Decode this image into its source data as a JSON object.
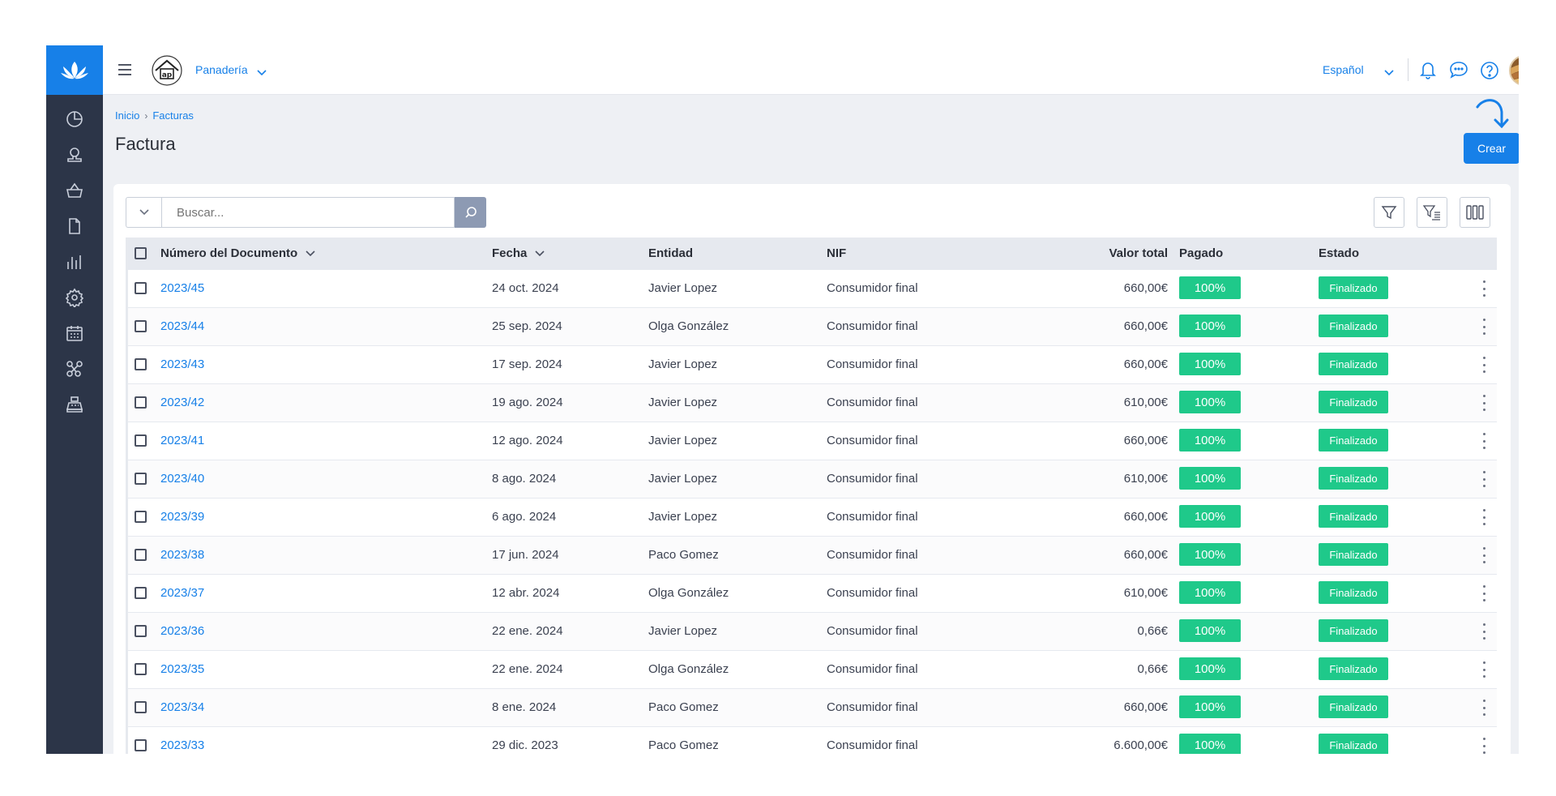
{
  "topbar": {
    "company": "Panadería",
    "language": "Español"
  },
  "breadcrumb": [
    "Inicio",
    "Facturas"
  ],
  "page": {
    "title": "Factura",
    "create_label": "Crear"
  },
  "search": {
    "placeholder": "Buscar..."
  },
  "table": {
    "headers": {
      "number": "Número del Documento",
      "date": "Fecha",
      "entity": "Entidad",
      "nif": "NIF",
      "total": "Valor total",
      "paid": "Pagado",
      "status": "Estado"
    },
    "rows": [
      {
        "number": "2023/45",
        "date": "24 oct. 2024",
        "entity": "Javier Lopez",
        "nif": "Consumidor final",
        "total": "660,00€",
        "paid": "100%",
        "status": "Finalizado"
      },
      {
        "number": "2023/44",
        "date": "25 sep. 2024",
        "entity": "Olga González",
        "nif": "Consumidor final",
        "total": "660,00€",
        "paid": "100%",
        "status": "Finalizado"
      },
      {
        "number": "2023/43",
        "date": "17 sep. 2024",
        "entity": "Javier Lopez",
        "nif": "Consumidor final",
        "total": "660,00€",
        "paid": "100%",
        "status": "Finalizado"
      },
      {
        "number": "2023/42",
        "date": "19 ago. 2024",
        "entity": "Javier Lopez",
        "nif": "Consumidor final",
        "total": "610,00€",
        "paid": "100%",
        "status": "Finalizado"
      },
      {
        "number": "2023/41",
        "date": "12 ago. 2024",
        "entity": "Javier Lopez",
        "nif": "Consumidor final",
        "total": "660,00€",
        "paid": "100%",
        "status": "Finalizado"
      },
      {
        "number": "2023/40",
        "date": "8 ago. 2024",
        "entity": "Javier Lopez",
        "nif": "Consumidor final",
        "total": "610,00€",
        "paid": "100%",
        "status": "Finalizado"
      },
      {
        "number": "2023/39",
        "date": "6 ago. 2024",
        "entity": "Javier Lopez",
        "nif": "Consumidor final",
        "total": "660,00€",
        "paid": "100%",
        "status": "Finalizado"
      },
      {
        "number": "2023/38",
        "date": "17 jun. 2024",
        "entity": "Paco Gomez",
        "nif": "Consumidor final",
        "total": "660,00€",
        "paid": "100%",
        "status": "Finalizado"
      },
      {
        "number": "2023/37",
        "date": "12 abr. 2024",
        "entity": "Olga González",
        "nif": "Consumidor final",
        "total": "610,00€",
        "paid": "100%",
        "status": "Finalizado"
      },
      {
        "number": "2023/36",
        "date": "22 ene. 2024",
        "entity": "Javier Lopez",
        "nif": "Consumidor final",
        "total": "0,66€",
        "paid": "100%",
        "status": "Finalizado"
      },
      {
        "number": "2023/35",
        "date": "22 ene. 2024",
        "entity": "Olga González",
        "nif": "Consumidor final",
        "total": "0,66€",
        "paid": "100%",
        "status": "Finalizado"
      },
      {
        "number": "2023/34",
        "date": "8 ene. 2024",
        "entity": "Paco Gomez",
        "nif": "Consumidor final",
        "total": "660,00€",
        "paid": "100%",
        "status": "Finalizado"
      },
      {
        "number": "2023/33",
        "date": "29 dic. 2023",
        "entity": "Paco Gomez",
        "nif": "Consumidor final",
        "total": "6.600,00€",
        "paid": "100%",
        "status": "Finalizado"
      }
    ]
  },
  "colors": {
    "accent": "#1780e8",
    "sidebar": "#2c3548",
    "success": "#1fc98a"
  },
  "icons": {
    "sidebar": [
      "dashboard-icon",
      "contacts-icon",
      "basket-icon",
      "document-icon",
      "reports-icon",
      "settings-icon",
      "calendar-icon",
      "integrations-icon",
      "cash-register-icon"
    ],
    "topbar": [
      "menu-icon",
      "bell-icon",
      "chat-icon",
      "help-icon",
      "more-vertical-icon"
    ],
    "toolbar": [
      "filter-icon",
      "advanced-filter-icon",
      "columns-icon"
    ]
  }
}
